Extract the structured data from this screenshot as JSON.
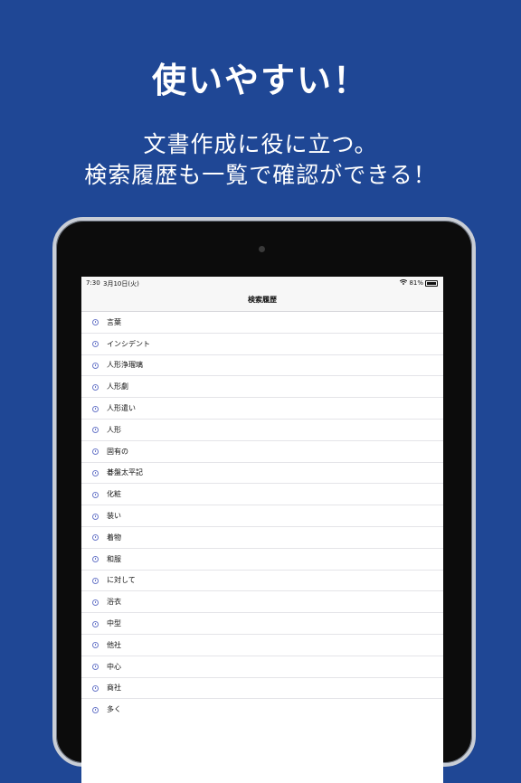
{
  "promo": {
    "headline": "使いやすい！",
    "sub_line1": "文書作成に役に立つ。",
    "sub_line2": "検索履歴も一覧で確認ができる！"
  },
  "colors": {
    "background": "#1f4795",
    "accent": "#6b79c9"
  },
  "status_bar": {
    "time": "7:30",
    "date": "3月10日(火)",
    "battery": "81%"
  },
  "screen": {
    "title": "検索履歴"
  },
  "history": [
    {
      "label": "言葉"
    },
    {
      "label": "インシデント"
    },
    {
      "label": "人形浄瑠璃"
    },
    {
      "label": "人形劇"
    },
    {
      "label": "人形遣い"
    },
    {
      "label": "人形"
    },
    {
      "label": "固有の"
    },
    {
      "label": "碁盤太平記"
    },
    {
      "label": "化粧"
    },
    {
      "label": "装い"
    },
    {
      "label": "着物"
    },
    {
      "label": "和服"
    },
    {
      "label": "に対して"
    },
    {
      "label": "浴衣"
    },
    {
      "label": "中型"
    },
    {
      "label": "他社"
    },
    {
      "label": "中心"
    },
    {
      "label": "商社"
    },
    {
      "label": "多く"
    }
  ]
}
